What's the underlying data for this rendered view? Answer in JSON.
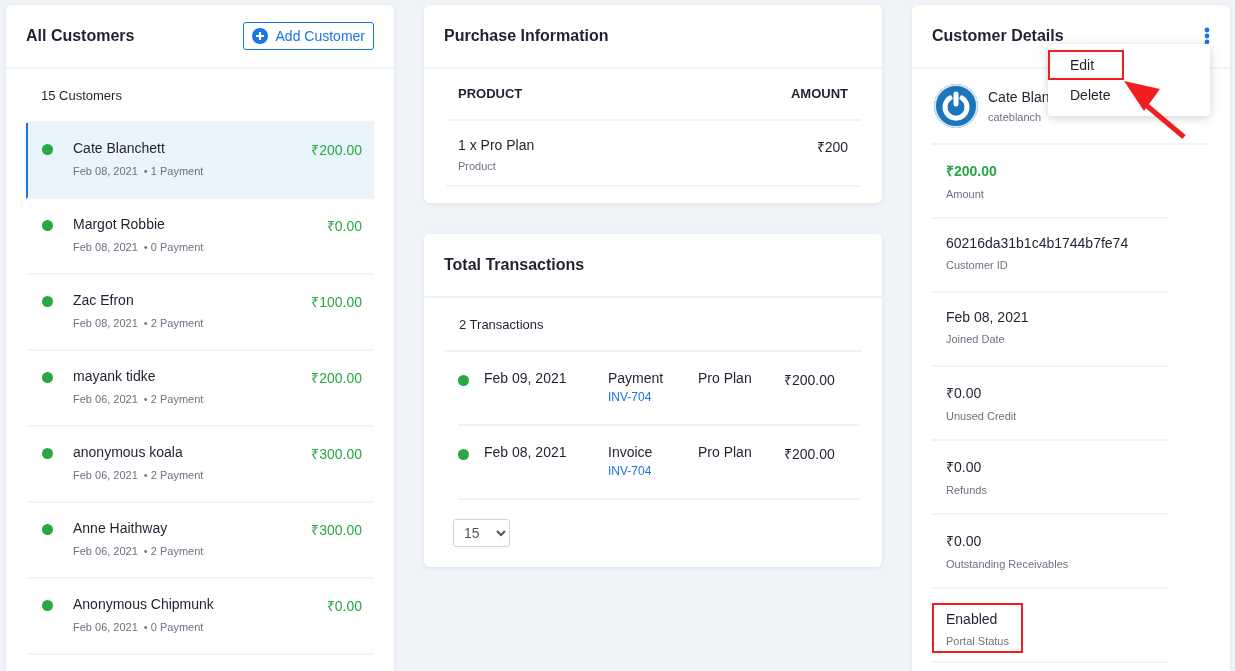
{
  "customers_panel": {
    "title": "All Customers",
    "add_button": "Add Customer",
    "count": "15 Customers",
    "customers": [
      {
        "name": "Cate Blanchett",
        "date": "Feb 08, 2021",
        "payments": "• 1 Payment",
        "amount": "₹200.00",
        "selected": true
      },
      {
        "name": "Margot Robbie",
        "date": "Feb 08, 2021",
        "payments": "• 0 Payment",
        "amount": "₹0.00",
        "selected": false
      },
      {
        "name": "Zac Efron",
        "date": "Feb 08, 2021",
        "payments": "• 2 Payment",
        "amount": "₹100.00",
        "selected": false
      },
      {
        "name": "mayank tidke",
        "date": "Feb 06, 2021",
        "payments": "• 2 Payment",
        "amount": "₹200.00",
        "selected": false
      },
      {
        "name": "anonymous koala",
        "date": "Feb 06, 2021",
        "payments": "• 2 Payment",
        "amount": "₹300.00",
        "selected": false
      },
      {
        "name": "Anne Haithway",
        "date": "Feb 06, 2021",
        "payments": "• 2 Payment",
        "amount": "₹300.00",
        "selected": false
      },
      {
        "name": "Anonymous Chipmunk",
        "date": "Feb 06, 2021",
        "payments": "• 0 Payment",
        "amount": "₹0.00",
        "selected": false
      }
    ]
  },
  "purchase_panel": {
    "title": "Purchase Information",
    "columns": [
      "PRODUCT",
      "AMOUNT"
    ],
    "rows": [
      {
        "product": "1 x Pro Plan",
        "type": "Product",
        "amount": "₹200"
      }
    ]
  },
  "transactions_panel": {
    "title": "Total Transactions",
    "count": "2 Transactions",
    "rows": [
      {
        "date": "Feb 09, 2021",
        "type": "Payment",
        "invoice": "INV-704",
        "plan": "Pro Plan",
        "amount": "₹200.00"
      },
      {
        "date": "Feb 08, 2021",
        "type": "Invoice",
        "invoice": "INV-704",
        "plan": "Pro Plan",
        "amount": "₹200.00"
      }
    ],
    "page_size": "15"
  },
  "details_panel": {
    "title": "Customer Details",
    "name": "Cate Blan",
    "email": "cateblanch",
    "menu": [
      {
        "label": "Edit",
        "highlighted": true
      },
      {
        "label": "Delete",
        "highlighted": false
      }
    ],
    "fields": [
      {
        "kind": "amount",
        "value": "₹200.00",
        "label": "Amount",
        "highlighted": false
      },
      {
        "kind": "plain",
        "value": "60216da31b1c4b1744b7fe74",
        "label": "Customer ID",
        "highlighted": false
      },
      {
        "kind": "plain",
        "value": "Feb 08, 2021",
        "label": "Joined Date",
        "highlighted": false
      },
      {
        "kind": "plain",
        "value": "₹0.00",
        "label": "Unused Credit",
        "highlighted": false
      },
      {
        "kind": "plain",
        "value": "₹0.00",
        "label": "Refunds",
        "highlighted": false
      },
      {
        "kind": "plain",
        "value": "₹0.00",
        "label": "Outstanding Receivables",
        "highlighted": false
      },
      {
        "kind": "plain",
        "value": "Enabled",
        "label": "Portal Status",
        "highlighted": true
      }
    ]
  }
}
